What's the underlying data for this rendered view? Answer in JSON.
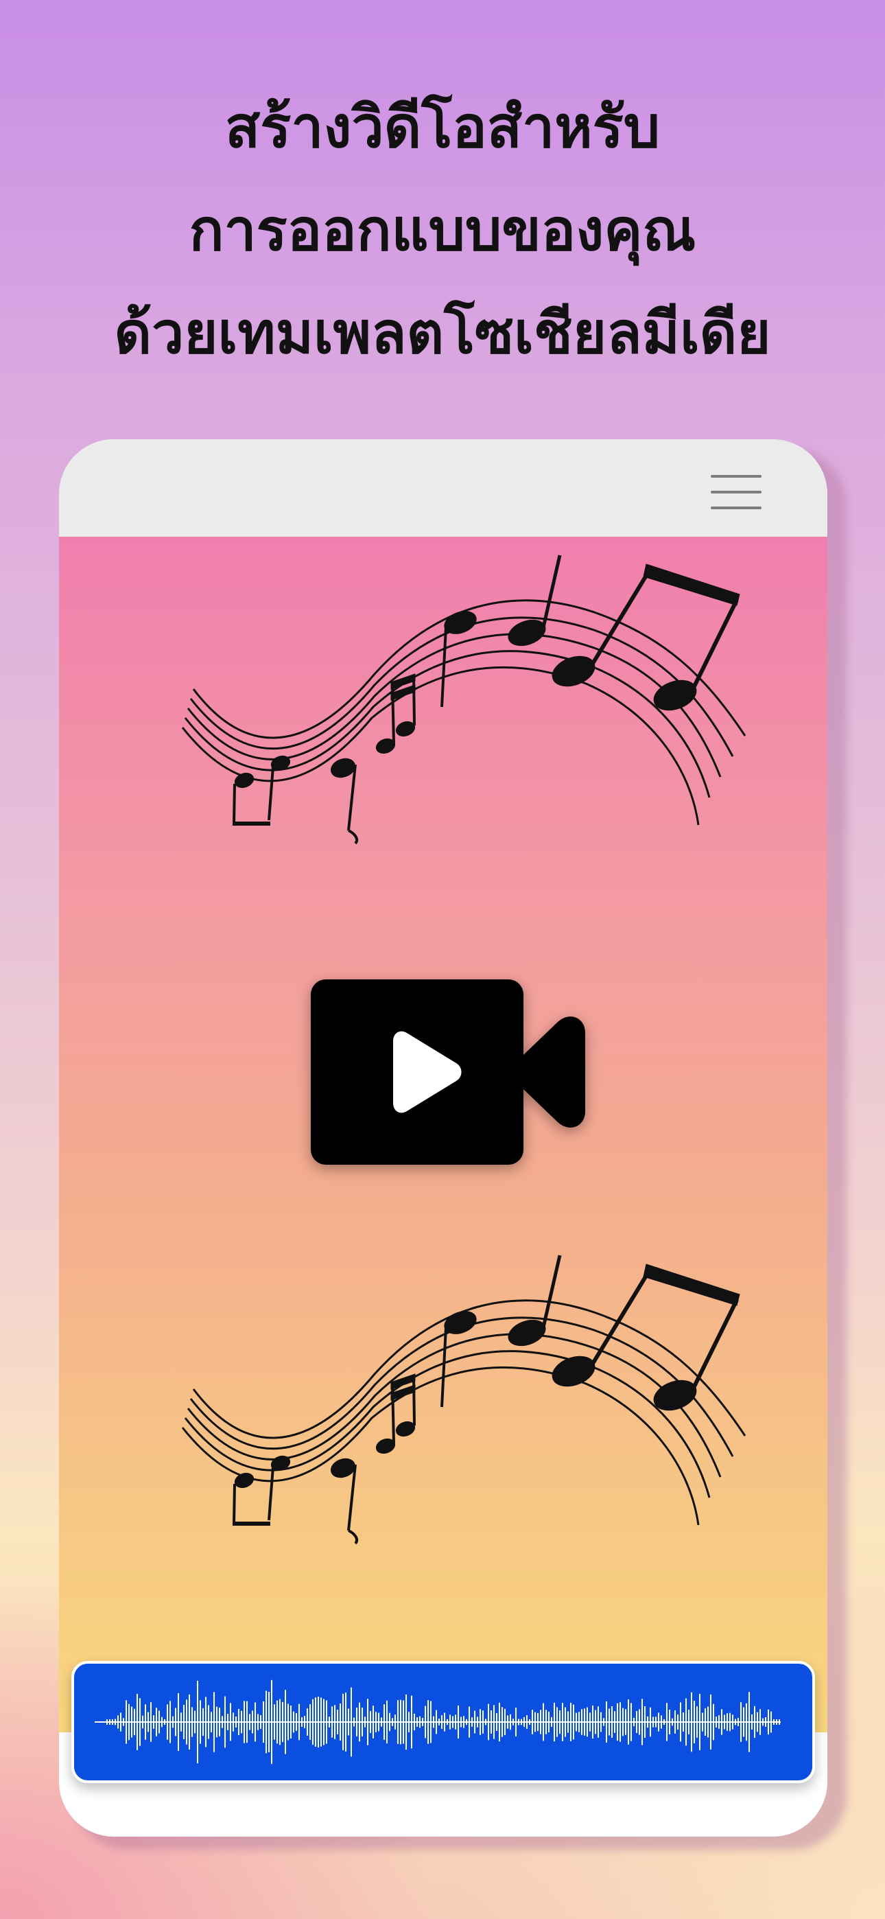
{
  "headline": {
    "line1": "สร้างวิดีโอสำหรับ",
    "line2": "การออกแบบของคุณ",
    "line3": "ด้วยเทมเพลตโซเชียลมีเดีย"
  },
  "icons": {
    "menu": "hamburger-menu-icon",
    "notes": "music-notes-icon",
    "video": "video-camera-play-icon",
    "waveform": "audio-waveform-icon"
  },
  "colors": {
    "waveform_background": "#0a4fe0",
    "stage_top": "#f07fae",
    "stage_bottom": "#f9d77e"
  }
}
